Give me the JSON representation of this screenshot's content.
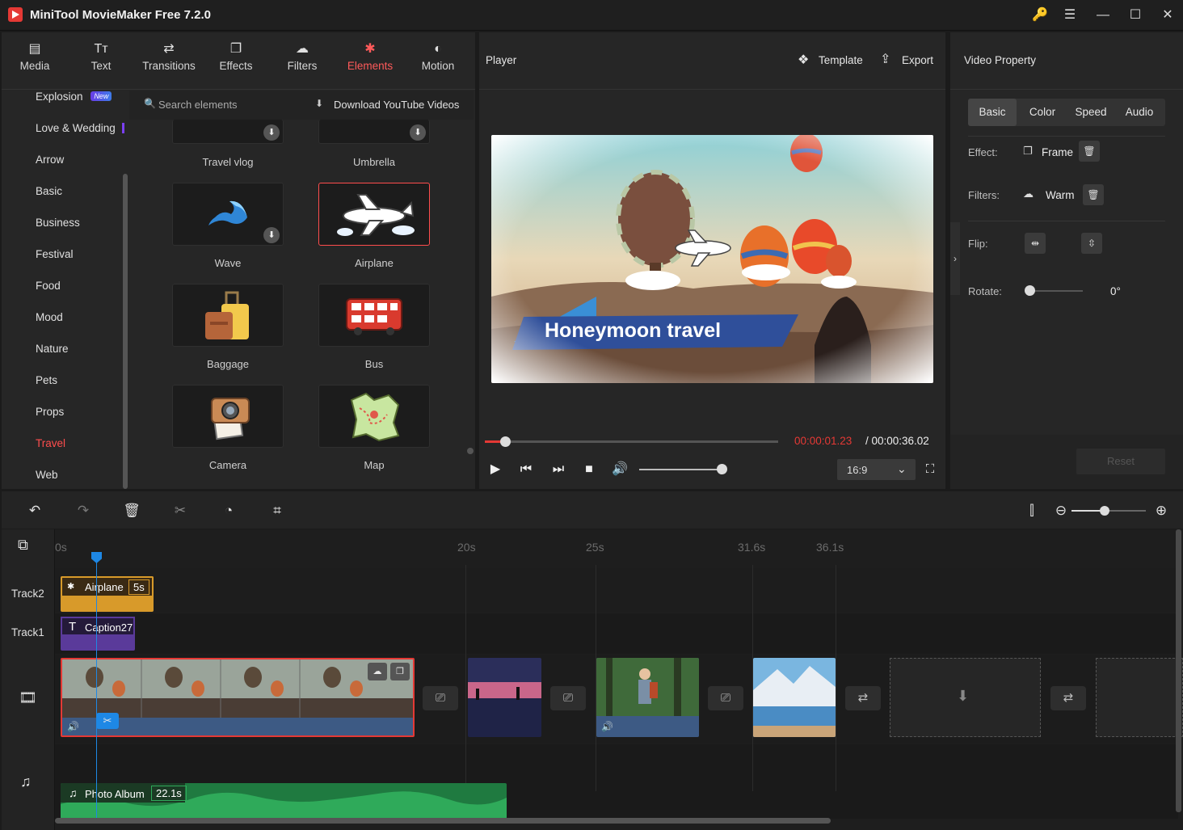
{
  "app": {
    "title": "MiniTool MovieMaker Free 7.2.0"
  },
  "window": {
    "key_icon": "key-icon",
    "menu_icon": "hamburger-icon"
  },
  "tabs": [
    {
      "label": "Media",
      "icon": "media-icon"
    },
    {
      "label": "Text",
      "icon": "text-icon"
    },
    {
      "label": "Transitions",
      "icon": "transitions-icon"
    },
    {
      "label": "Effects",
      "icon": "effects-icon"
    },
    {
      "label": "Filters",
      "icon": "filters-icon"
    },
    {
      "label": "Elements",
      "icon": "elements-icon",
      "active": true
    },
    {
      "label": "Motion",
      "icon": "motion-icon"
    }
  ],
  "categories": [
    {
      "label": "Explosion",
      "badge": "New"
    },
    {
      "label": "Love & Wedding"
    },
    {
      "label": "Arrow"
    },
    {
      "label": "Basic"
    },
    {
      "label": "Business"
    },
    {
      "label": "Festival"
    },
    {
      "label": "Food"
    },
    {
      "label": "Mood"
    },
    {
      "label": "Nature"
    },
    {
      "label": "Pets"
    },
    {
      "label": "Props"
    },
    {
      "label": "Travel",
      "active": true
    },
    {
      "label": "Web"
    }
  ],
  "search": {
    "placeholder": "Search elements",
    "download_label": "Download YouTube Videos"
  },
  "elements": [
    {
      "label": "Travel vlog"
    },
    {
      "label": "Umbrella"
    },
    {
      "label": "Wave"
    },
    {
      "label": "Airplane",
      "selected": true
    },
    {
      "label": "Baggage"
    },
    {
      "label": "Bus"
    },
    {
      "label": "Camera"
    },
    {
      "label": "Map"
    }
  ],
  "player": {
    "title": "Player",
    "template_label": "Template",
    "export_label": "Export",
    "caption_text": "Honeymoon travel",
    "current_time": "00:00:01.23",
    "total_time": "/ 00:00:36.02",
    "aspect_ratio": "16:9",
    "progress": 0.07,
    "volume": 0.9
  },
  "property": {
    "title": "Video Property",
    "tabs": [
      "Basic",
      "Color",
      "Speed",
      "Audio"
    ],
    "effect_label": "Effect:",
    "effect_value": "Frame",
    "filters_label": "Filters:",
    "filters_value": "Warm",
    "flip_label": "Flip:",
    "rotate_label": "Rotate:",
    "rotate_value": "0°",
    "reset_label": "Reset"
  },
  "timeline": {
    "ruler": [
      "0s",
      "20s",
      "25s",
      "31.6s",
      "36.1s"
    ],
    "tracks": [
      "Track2",
      "Track1"
    ],
    "clip_airplane": {
      "name": "Airplane",
      "duration": "5s"
    },
    "clip_caption": {
      "name": "Caption27"
    },
    "audio": {
      "name": "Photo Album",
      "duration": "22.1s"
    }
  },
  "colors": {
    "accent": "#ff4d4d",
    "playhead": "#1e88e5",
    "element_clip": "#d89a2a",
    "caption_clip": "#5a3a9a",
    "audio_clip": "#2e9e52"
  }
}
